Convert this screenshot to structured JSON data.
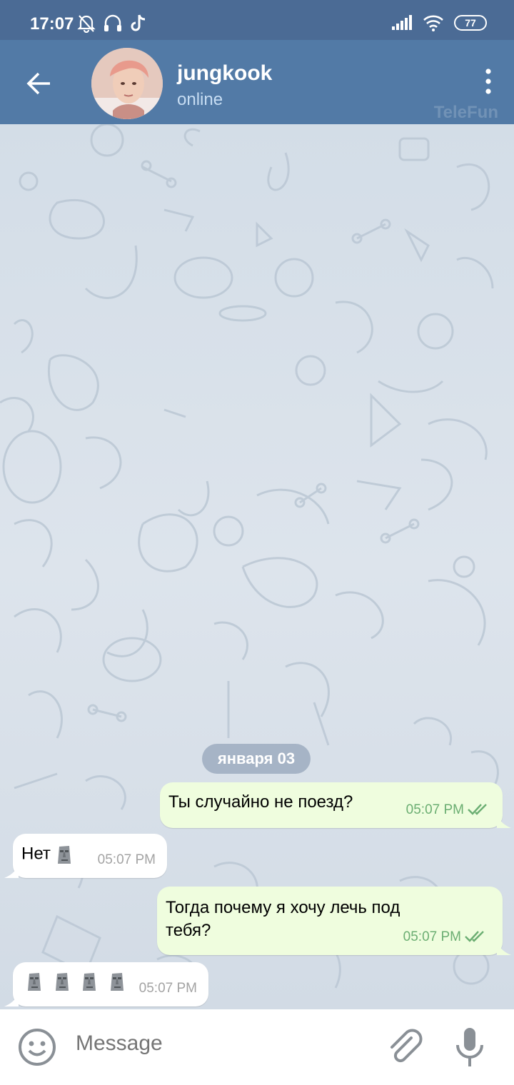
{
  "status_bar": {
    "time": "17:07",
    "battery": "77"
  },
  "header": {
    "name": "jungkook",
    "status": "online",
    "watermark": "TeleFun"
  },
  "chat": {
    "date": "января 03",
    "messages": [
      {
        "dir": "out",
        "text": "Ты случайно не поезд?",
        "time": "05:07 PM",
        "read": true
      },
      {
        "dir": "in",
        "text": "Нет",
        "emoji": "moai",
        "emoji_count": 1,
        "time": "05:07 PM"
      },
      {
        "dir": "out",
        "line1": "Тогда почему я хочу лечь под",
        "line2": "тебя?",
        "time": "05:07 PM",
        "read": true
      },
      {
        "dir": "in",
        "emoji": "moai",
        "emoji_count": 4,
        "time": "05:07 PM"
      }
    ]
  },
  "input": {
    "placeholder": "Message"
  },
  "colors": {
    "header": "#527aa6",
    "status_bar": "#4b6b95",
    "out_bubble": "#effdde",
    "check": "#6bae72"
  },
  "icons": [
    "bell-off-icon",
    "headphones-icon",
    "tiktok-icon",
    "signal-icon",
    "wifi-icon",
    "battery-icon",
    "back-arrow-icon",
    "more-vert-icon",
    "emoji-icon",
    "paperclip-icon",
    "microphone-icon",
    "double-check-icon",
    "moai-emoji"
  ]
}
